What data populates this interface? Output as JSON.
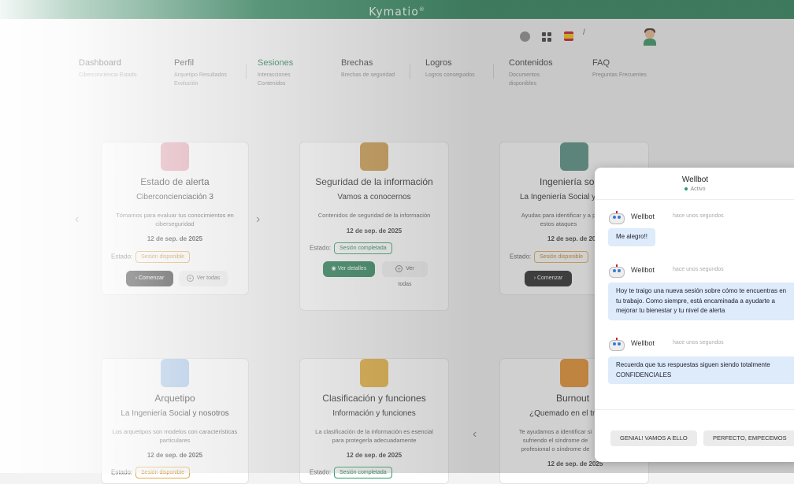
{
  "app": {
    "brand": "Kymatio",
    "brand_mark": "®"
  },
  "header": {
    "slash": "/",
    "icons": [
      "user-circle-icon",
      "grid-icon",
      "spain-flag-icon",
      "avatar"
    ]
  },
  "nav": [
    {
      "title": "Dashboard",
      "sub": "Ciberconciencia Estado",
      "active": false
    },
    {
      "title": "Perfil",
      "sub": "Arquetipo Resultados Evolución",
      "active": false
    },
    {
      "title": "Sesiones",
      "sub": "Interacciones Contenidos",
      "active": true
    },
    {
      "title": "Brechas",
      "sub": "Brechas de seguridad",
      "active": false
    },
    {
      "title": "Logros",
      "sub": "Logros conseguidos",
      "active": false
    },
    {
      "title": "Contenidos",
      "sub": "Documentos disponibles",
      "active": false
    },
    {
      "title": "FAQ",
      "sub": "Preguntas Frecuentes",
      "active": false
    }
  ],
  "cards": [
    {
      "title": "Estado de alerta",
      "sub": "Ciberconcienciación 3",
      "desc": "Tómamos para evaluar tus conocimientos en ciberseguridad",
      "date": "12 de sep. de 2025",
      "estado_label": "Estado:",
      "estado": "Sesión disponible",
      "primary": "Comenzar",
      "secondary": "Ver todas",
      "icon_color": "#e9a6b4"
    },
    {
      "title": "Seguridad de la información",
      "sub": "Vamos a conocernos",
      "desc": "Contenidos de seguridad de la información",
      "date": "12 de sep. de 2025",
      "estado_label": "Estado:",
      "estado": "Sesión completada",
      "primary": "Ver detalles",
      "secondary": "Ver todas",
      "icon_color": "#c8933f"
    },
    {
      "title": "Ingeniería soc",
      "sub": "La Ingeniería Social y",
      "desc": "Ayudas para identificar y a p estos ataques",
      "date": "12 de sep. de 2025",
      "estado_label": "Estado:",
      "estado": "Sesión disponible",
      "primary": "Comenzar",
      "secondary": "",
      "icon_color": "#4e8a7c"
    },
    {
      "title": "Arquetipo",
      "sub": "La Ingeniería Social y nosotros",
      "desc": "Los arquetipos son modelos con características particulares",
      "date": "12 de sep. de 2025",
      "estado_label": "Estado:",
      "estado": "Sesión disponible",
      "icon_color": "#a8c8ef"
    },
    {
      "title": "Clasificación y funciones",
      "sub": "Información y funciones",
      "desc": "La clasificación de la información es esencial para protegerla adecuadamente",
      "date": "12 de sep. de 2025",
      "estado_label": "Estado:",
      "estado": "Sesión completada",
      "icon_color": "#e0a92e"
    },
    {
      "title": "Burnout",
      "sub": "¿Quemado en el tr",
      "desc": "Te ayudamos a identificar si sufriendo el síndrome de profesional o síndrome de",
      "date": "12 de sep. de 2025",
      "icon_color": "#e58a22"
    }
  ],
  "chat": {
    "title": "Wellbot",
    "status": "Activo",
    "messages": [
      {
        "name": "Wellbot",
        "time": "hace unos segundos",
        "text": "Me alegro!!"
      },
      {
        "name": "Wellbot",
        "time": "hace unos segundos",
        "text": "Hoy te traigo una nueva sesión sobre cómo te encuentras en tu trabajo. Como siempre, está encaminada a ayudarte a mejorar tu bienestar y tu nivel de alerta"
      },
      {
        "name": "Wellbot",
        "time": "hace unos segundos",
        "text": "Recuerda que tus respuestas siguen siendo totalmente CONFIDENCIALES"
      }
    ],
    "quick_replies": [
      "GENIAL! VAMOS A ELLO",
      "PERFECTO, EMPECEMOS"
    ]
  }
}
